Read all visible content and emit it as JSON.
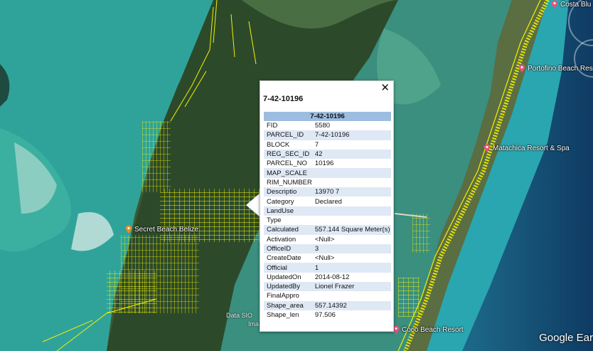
{
  "popup": {
    "title": "7-42-10196",
    "close_icon": "close-icon",
    "table_header": "7-42-10196",
    "rows": [
      {
        "key": "FID",
        "value": "5580"
      },
      {
        "key": "PARCEL_ID",
        "value": "7-42-10196"
      },
      {
        "key": "BLOCK",
        "value": "7"
      },
      {
        "key": "REG_SEC_ID",
        "value": "42"
      },
      {
        "key": "PARCEL_NO",
        "value": "10196"
      },
      {
        "key": "MAP_SCALE",
        "value": ""
      },
      {
        "key": "RIM_NUMBER",
        "value": ""
      },
      {
        "key": "Descriptio",
        "value": "13970 7"
      },
      {
        "key": "Category",
        "value": "Declared"
      },
      {
        "key": "LandUse",
        "value": ""
      },
      {
        "key": "Type",
        "value": ""
      },
      {
        "key": "Calculated",
        "value": "557.144 Square Meter(s)"
      },
      {
        "key": "Activation",
        "value": "<Null>"
      },
      {
        "key": "OfficeID",
        "value": "3"
      },
      {
        "key": "CreateDate",
        "value": "<Null>"
      },
      {
        "key": "Official",
        "value": "1"
      },
      {
        "key": "UpdatedOn",
        "value": "2014-08-12"
      },
      {
        "key": "UpdatedBy",
        "value": "Lionel Frazer"
      },
      {
        "key": "FinalAppro",
        "value": ""
      },
      {
        "key": "Shape_area",
        "value": "557.14392"
      },
      {
        "key": "Shape_len",
        "value": "97.506"
      }
    ]
  },
  "places": [
    {
      "name": "Costa Blu",
      "icon": "pink-pin-icon"
    },
    {
      "name": "Portofino Beach Res",
      "icon": "pink-pin-icon"
    },
    {
      "name": "Matachica Resort & Spa",
      "icon": "pink-pin-icon"
    },
    {
      "name": "Secret Beach Belize",
      "icon": "orange-pin-icon"
    },
    {
      "name": "Coco Beach Resort",
      "icon": "pink-pin-icon"
    }
  ],
  "attribution": {
    "line1": "Data SIO",
    "line2": "Ima"
  },
  "brand": "Google Ear",
  "colors": {
    "parcel_lines": "#f5f000",
    "header_row": "#9cbde0",
    "alt_row": "#dfe9f5",
    "pink_pin": "#e8537a",
    "orange_pin": "#f08a24",
    "lagoon": "#2fa39a",
    "sea": "#1a4f7a"
  }
}
